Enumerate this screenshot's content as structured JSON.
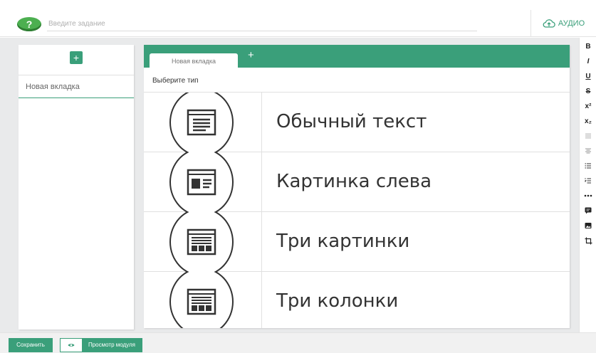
{
  "header": {
    "help_icon": "question-icon",
    "help_glyph": "?",
    "task_placeholder": "Введите задание",
    "audio_label": "АУДИО",
    "audio_icon": "cloud-upload-icon"
  },
  "sidebar": {
    "add_glyph": "+",
    "pages": [
      {
        "label": "Новая вкладка"
      }
    ]
  },
  "editor": {
    "tabs": [
      {
        "label": "Новая вкладка"
      }
    ],
    "add_tab_glyph": "+",
    "choose_type": "Выберите тип",
    "types": [
      {
        "label": "Обычный текст",
        "icon": "text-layout-icon"
      },
      {
        "label": "Картинка слева",
        "icon": "image-left-layout-icon"
      },
      {
        "label": "Три картинки",
        "icon": "three-images-layout-icon"
      },
      {
        "label": "Три колонки",
        "icon": "three-columns-layout-icon"
      }
    ]
  },
  "format_toolbar": {
    "bold": "B",
    "italic": "I",
    "underline": "U",
    "strike": "S",
    "superscript": "x²",
    "subscript": "x₂"
  },
  "footer": {
    "save_label": "Сохранить",
    "preview_label": "Просмотр модуля",
    "preview_icon": "eye-icon"
  },
  "colors": {
    "accent": "#3a9f7a",
    "help_green": "#4caf50",
    "workspace_bg": "#e9eaeb"
  }
}
